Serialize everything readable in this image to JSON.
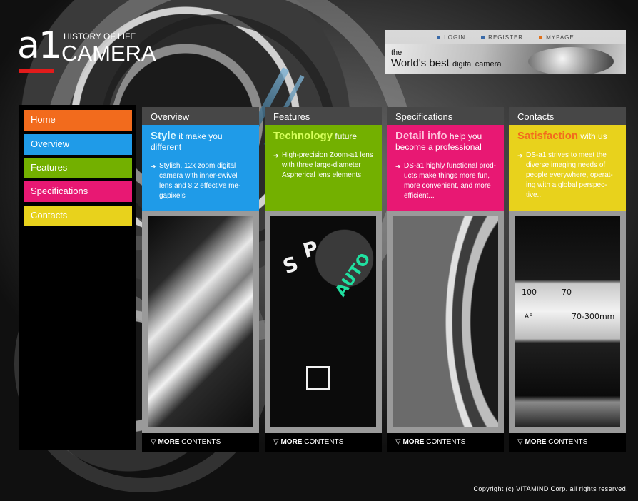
{
  "logo": {
    "mark": "a1",
    "tagline": "HISTORY OF LIFE",
    "name": "CAMERA"
  },
  "top_nav": [
    {
      "label": "LOGIN",
      "color": "#3a6aa8"
    },
    {
      "label": "REGISTER",
      "color": "#3a6aa8"
    },
    {
      "label": "MYPAGE",
      "color": "#e0701a"
    }
  ],
  "banner": {
    "the": "the",
    "main": "World's best",
    "small": "digital camera"
  },
  "sidebar": {
    "items": [
      {
        "label": "Home",
        "color": "#f26b1d"
      },
      {
        "label": "Overview",
        "color": "#1f9be8"
      },
      {
        "label": "Features",
        "color": "#73b000"
      },
      {
        "label": "Specifications",
        "color": "#e81873"
      },
      {
        "label": "Contacts",
        "color": "#e8d21c"
      }
    ]
  },
  "columns": [
    {
      "title": "Overview",
      "color": "#1f9be8",
      "headline_strong": "Style",
      "headline_rest": " it make you different",
      "desc": "Stylish, 12x zoom digital camera with inner-swivel lens and 8.2 effective me-gapixels",
      "more_strong": "MORE",
      "more_rest": " CONTENTS"
    },
    {
      "title": "Features",
      "color": "#73b000",
      "headline_strong": "Technology",
      "headline_rest": " future",
      "desc": "High-precision Zoom-a1 lens with three large-diameter Aspherical lens elements",
      "more_strong": "MORE",
      "more_rest": " CONTENTS"
    },
    {
      "title": "Specifications",
      "color": "#e81873",
      "headline_strong": "Detail info",
      "headline_rest": " help you become a professional",
      "desc": "DS-a1 highly functional prod-ucts make things more fun, more convenient, and more efficient...",
      "more_strong": "MORE",
      "more_rest": " CONTENTS"
    },
    {
      "title": "Contacts",
      "color": "#e8d21c",
      "headline_strong": "Satisfaction",
      "headline_rest": " with us",
      "desc": "DS-a1 strives to meet the diverse imaging needs of people everywhere, operat-ing with a global perspec-tive...",
      "more_strong": "MORE",
      "more_rest": " CONTENTS"
    }
  ],
  "photo_labels": {
    "dial": [
      "S",
      "P",
      "AUTO"
    ],
    "lens_numbers": [
      "100",
      "70",
      "70-300mm",
      "AF"
    ]
  },
  "copyright": "Copyright (c) VITAMIND Corp. all rights reserved."
}
